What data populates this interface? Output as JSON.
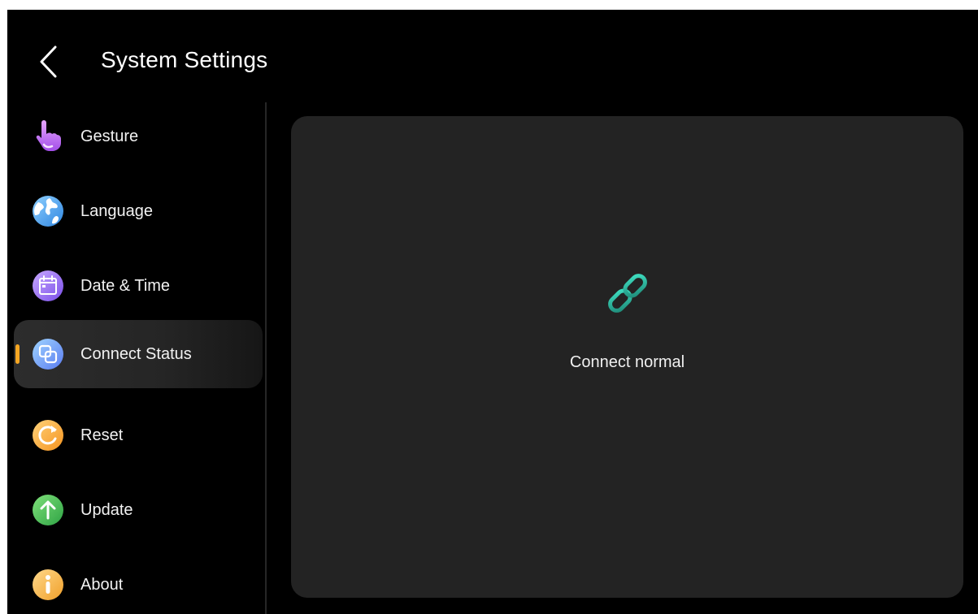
{
  "header": {
    "title": "System Settings",
    "back_icon": "chevron-left-icon"
  },
  "sidebar": {
    "items": [
      {
        "label": "Gesture",
        "icon": "pointing-hand-icon",
        "selected": false
      },
      {
        "label": "Language",
        "icon": "globe-icon",
        "selected": false
      },
      {
        "label": "Date & Time",
        "icon": "calendar-icon",
        "selected": false
      },
      {
        "label": "Connect Status",
        "icon": "overlapping-squares-icon",
        "selected": true
      },
      {
        "label": "Reset",
        "icon": "refresh-icon",
        "selected": false
      },
      {
        "label": "Update",
        "icon": "arrow-up-icon",
        "selected": false
      },
      {
        "label": "About",
        "icon": "info-icon",
        "selected": false
      }
    ]
  },
  "main": {
    "status_icon": "link-icon",
    "status_text": "Connect normal"
  },
  "colors": {
    "background": "#000000",
    "panel": "#232323",
    "selected_indicator": "#f5a623",
    "link_accent": "#2ec4a6"
  }
}
